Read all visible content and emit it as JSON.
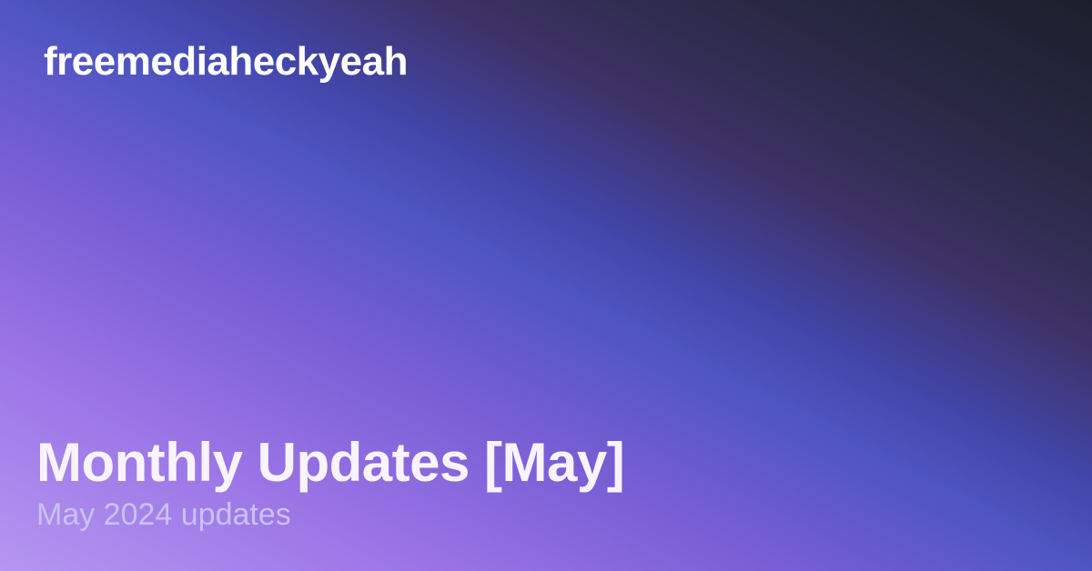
{
  "site": {
    "name": "freemediaheckyeah"
  },
  "post": {
    "title": "Monthly Updates [May]",
    "subtitle": "May 2024 updates"
  },
  "colors": {
    "gradient_light": "#b596f0",
    "gradient_mid": "#4f55c2",
    "gradient_dark": "#1b1f2b",
    "title_text": "#f7f4ff",
    "subtitle_text": "#c9c2f4"
  }
}
